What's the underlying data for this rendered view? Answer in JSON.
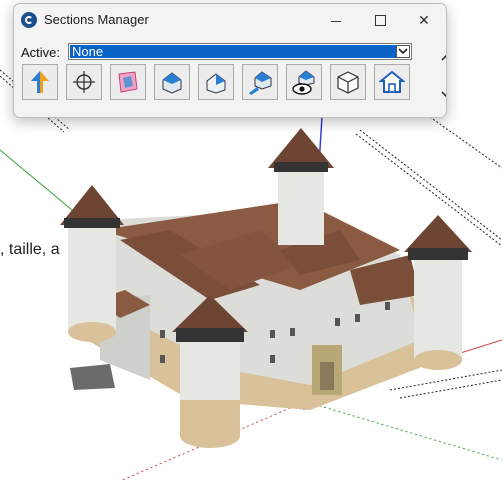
{
  "window": {
    "title": "Sections Manager",
    "minimize_glyph": "minimize-icon",
    "maximize_glyph": "maximize-icon",
    "close_glyph": "✕"
  },
  "active": {
    "label": "Active:",
    "value": "None"
  },
  "toolbar": {
    "tools": [
      "sections-manager-icon",
      "section-plane-target-icon",
      "display-section-cut-icon",
      "house-section-icon",
      "house-section-alt-icon",
      "house-section-arrow-icon",
      "house-eye-icon",
      "cube-icon",
      "house-outline-icon"
    ]
  },
  "background": {
    "text": ", taille, a"
  },
  "colors": {
    "accent": "#0a64c8",
    "sky": "#ffffff",
    "tower_wall": "#e8e8e6",
    "roof": "#7b4e3a",
    "axis_blue": "#3b3bd6",
    "axis_green": "#33a233",
    "axis_red": "#d04040"
  }
}
